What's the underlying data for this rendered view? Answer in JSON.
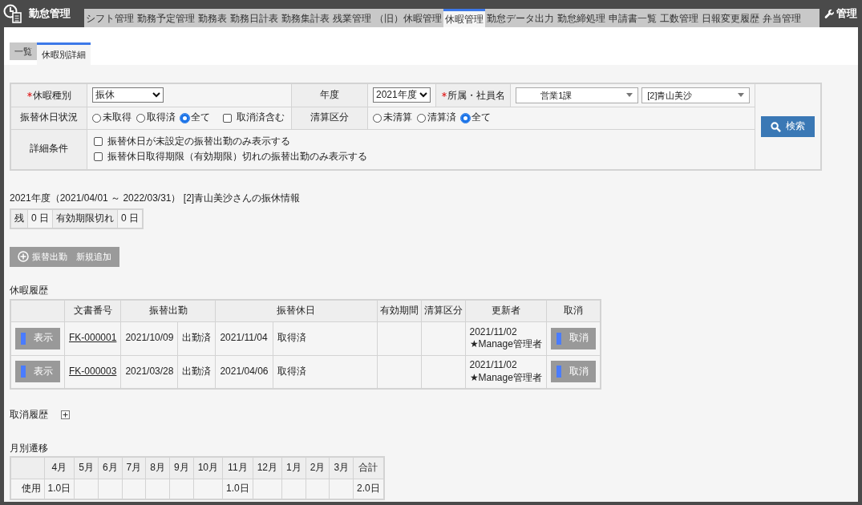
{
  "app": {
    "title": "勤怠管理"
  },
  "nav": [
    {
      "label": "シフト管理",
      "selected": false
    },
    {
      "label": "勤務予定管理",
      "selected": false
    },
    {
      "label": "勤務表",
      "selected": false
    },
    {
      "label": "勤務日計表",
      "selected": false
    },
    {
      "label": "勤務集計表",
      "selected": false
    },
    {
      "label": "残業管理",
      "selected": false
    },
    {
      "label": "（旧）休暇管理",
      "selected": false
    },
    {
      "label": "休暇管理",
      "selected": true
    },
    {
      "label": "勤怠データ出力",
      "selected": false
    },
    {
      "label": "勤怠締処理",
      "selected": false
    },
    {
      "label": "申請書一覧",
      "selected": false
    },
    {
      "label": "工数管理",
      "selected": false
    },
    {
      "label": "日報変更履歴",
      "selected": false
    },
    {
      "label": "弁当管理",
      "selected": false
    }
  ],
  "admin": {
    "label": "管理"
  },
  "subtabs": [
    {
      "label": "一覧",
      "selected": false
    },
    {
      "label": "休暇別詳細",
      "selected": true
    }
  ],
  "search": {
    "leave_type": {
      "label": "休暇種別",
      "required": true,
      "value": "振休"
    },
    "fiscal_year": {
      "label": "年度",
      "required": false,
      "value": "2021年度"
    },
    "affiliation": {
      "label": "所属・社員名",
      "required": true,
      "department": "営業1課",
      "employee": "[2]青山美沙"
    },
    "status": {
      "label": "振替休日状況",
      "options": [
        {
          "label": "未取得",
          "selected": false
        },
        {
          "label": "取得済",
          "selected": false
        },
        {
          "label": "全て",
          "selected": true
        }
      ],
      "include_cancelled": {
        "label": "取消済含む",
        "checked": false
      }
    },
    "settlement": {
      "label": "清算区分",
      "options": [
        {
          "label": "未清算",
          "selected": false
        },
        {
          "label": "清算済",
          "selected": false
        },
        {
          "label": "全て",
          "selected": true
        }
      ]
    },
    "details": {
      "label": "詳細条件",
      "options": [
        {
          "label": "振替休日が未設定の振替出勤のみ表示する",
          "checked": false
        },
        {
          "label": "振替休日取得期限（有効期限）切れの振替出勤のみ表示する",
          "checked": false
        }
      ]
    },
    "button": "検索"
  },
  "summary": {
    "title": "2021年度（2021/04/01 ～ 2022/03/31） [2]青山美沙さんの振休情報",
    "cells": [
      "残",
      "0 日",
      "有効期限切れ",
      "0 日"
    ]
  },
  "add_button": "振替出勤　新規追加",
  "history": {
    "title": "休暇履歴",
    "columns": [
      "文書番号",
      "振替出勤",
      "振替休日",
      "有効期間",
      "清算区分",
      "更新者",
      "取消"
    ],
    "rows": [
      {
        "view": "表示",
        "doc": "FK-000001",
        "work_date": "2021/10/09",
        "work_status": "出勤済",
        "holiday_date": "2021/11/04",
        "holiday_status": "取得済",
        "updated_date": "2021/11/02",
        "updated_by": "★Manage管理者",
        "cancel": "取消"
      },
      {
        "view": "表示",
        "doc": "FK-000003",
        "work_date": "2021/03/28",
        "work_status": "出勤済",
        "holiday_date": "2021/04/06",
        "holiday_status": "取得済",
        "updated_date": "2021/11/02",
        "updated_by": "★Manage管理者",
        "cancel": "取消"
      }
    ]
  },
  "cancel_history": {
    "title": "取消履歴",
    "expanded": false
  },
  "monthly": {
    "title": "月別遷移",
    "row_label": "使用",
    "columns": [
      {
        "label": "4月",
        "used": "1.0日"
      },
      {
        "label": "5月"
      },
      {
        "label": "6月"
      },
      {
        "label": "7月"
      },
      {
        "label": "8月"
      },
      {
        "label": "9月"
      },
      {
        "label": "10月"
      },
      {
        "label": "11月",
        "used": "1.0日"
      },
      {
        "label": "12月"
      },
      {
        "label": "1月"
      },
      {
        "label": "2月"
      },
      {
        "label": "3月"
      },
      {
        "label": "合計",
        "used": "2.0日"
      }
    ]
  }
}
